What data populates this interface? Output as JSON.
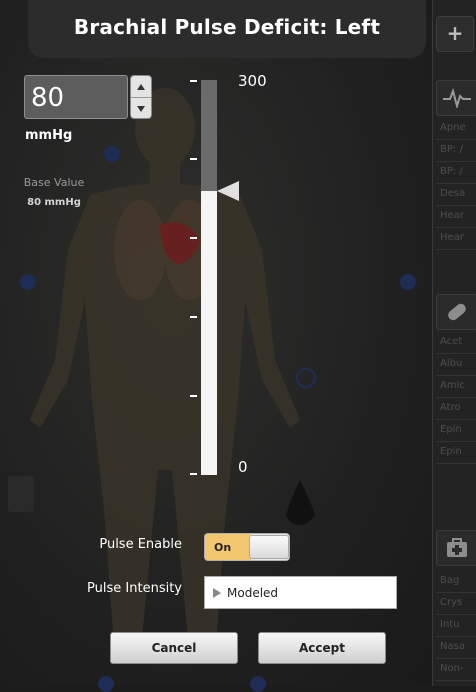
{
  "dialog": {
    "title": "Brachial Pulse Deficit: Left",
    "value": "80",
    "unit": "mmHg",
    "base_label": "Base Value",
    "base_value": "80 mmHg",
    "slider": {
      "max": "300",
      "min": "0",
      "level_fraction": 0.72
    },
    "pulse_enable_label": "Pulse Enable",
    "toggle_on_label": "On",
    "pulse_intensity_label": "Pulse Intensity",
    "pulse_intensity_value": "Modeled",
    "cancel_label": "Cancel",
    "accept_label": "Accept"
  },
  "background_panel": {
    "plus_icon": "plus-icon",
    "section_icons": [
      "heartbeat-icon",
      "pills-icon",
      "medkit-icon"
    ],
    "items_group1": [
      "Apne",
      "BP: /",
      "BP: /",
      "Desa",
      "Hear",
      "Hear"
    ],
    "items_group2": [
      "Acet",
      "Albu",
      "Amic",
      "Atro",
      "Epin",
      "Epin"
    ],
    "items_group3": [
      "Bag",
      "Crys",
      "Intu",
      "Nasa",
      "Non-"
    ]
  },
  "colors": {
    "toggle_on": "#f3c770",
    "marker_dot": "#1f2c55",
    "slider_fill": "#f5f5f5",
    "slider_upper": "#6b6b6b"
  }
}
